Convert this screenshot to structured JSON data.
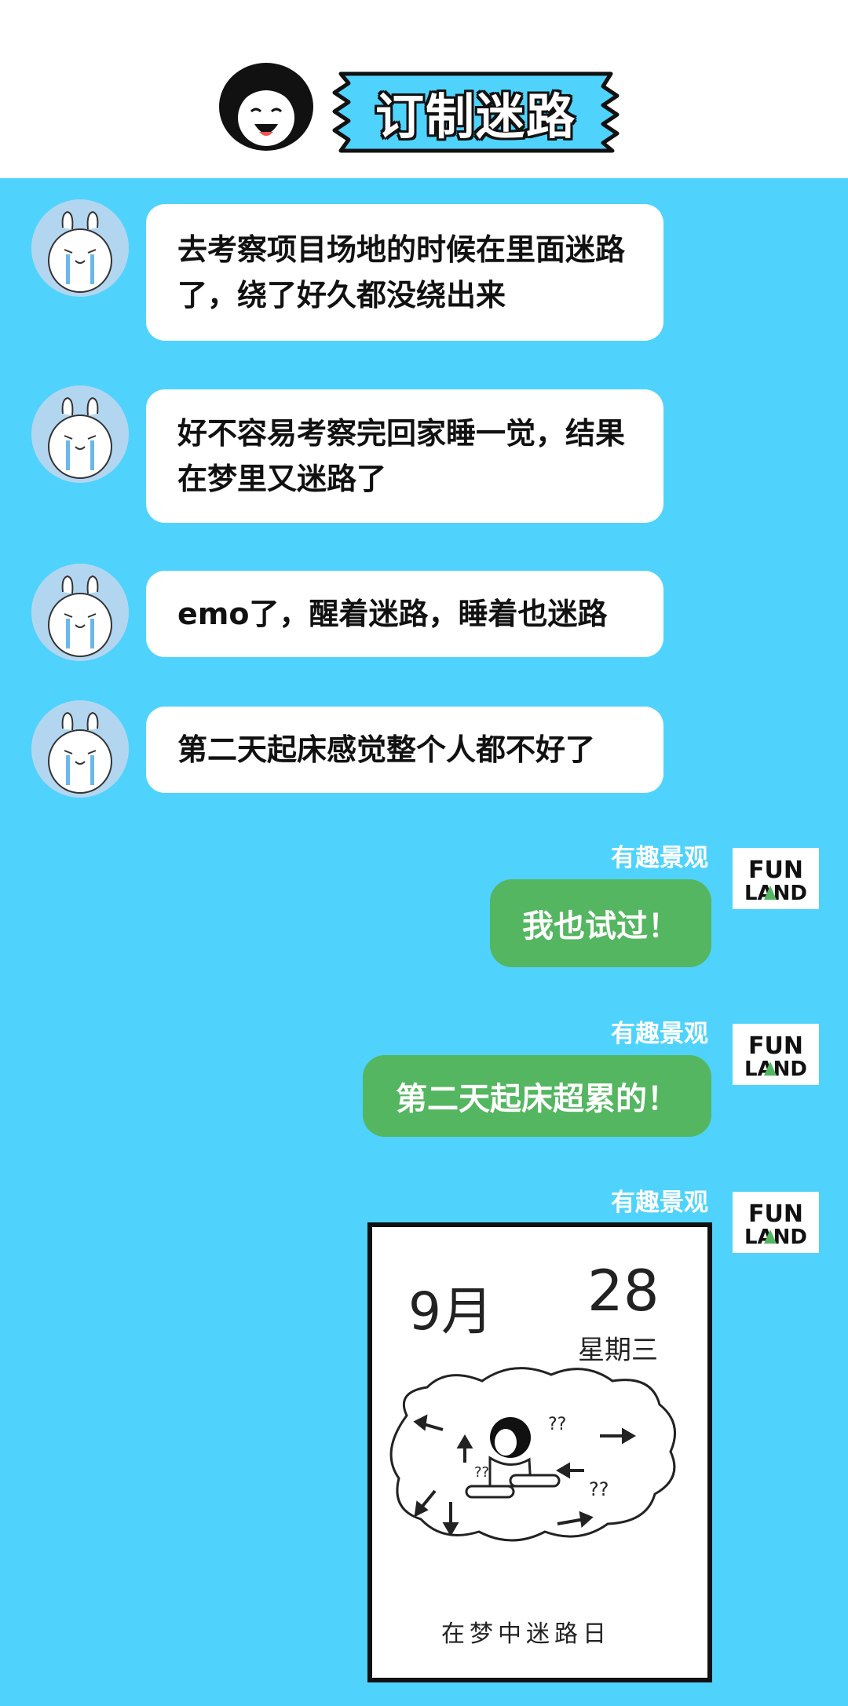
{
  "header": {
    "title": "订制迷路"
  },
  "messages": [
    {
      "side": "left",
      "text": "去考察项目场地的时候在里面迷路了，绕了好久都没绕出来"
    },
    {
      "side": "left",
      "text": "好不容易考察完回家睡一觉，结果在梦里又迷路了"
    },
    {
      "side": "left",
      "text": "emo了，醒着迷路，睡着也迷路"
    },
    {
      "side": "left",
      "text": "第二天起床感觉整个人都不好了"
    },
    {
      "side": "right",
      "sender": "有趣景观",
      "text": "我也试过！"
    },
    {
      "side": "right",
      "sender": "有趣景观",
      "text": "第二天起床超累的！"
    },
    {
      "side": "right",
      "sender": "有趣景观",
      "type": "image"
    }
  ],
  "logo": {
    "line1": "FUN",
    "line2": "LAND"
  },
  "calendar": {
    "month": "9月",
    "day": "28",
    "weekday": "星期三",
    "caption": "在梦中迷路日",
    "q1": "??",
    "q2": "??",
    "q3": "??"
  },
  "colors": {
    "background": "#4fd3fc",
    "bubble_left": "#ffffff",
    "bubble_right": "#54b660",
    "avatar": "#b3d6f0"
  },
  "icons": {
    "header": "girl-face-icon",
    "left_avatar": "crying-bunny-icon",
    "right_avatar": "funland-logo-icon"
  }
}
